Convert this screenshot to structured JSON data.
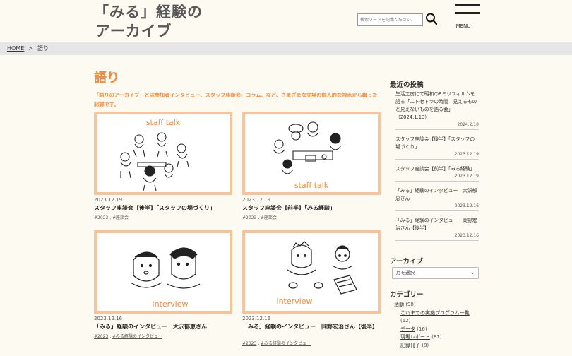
{
  "header": {
    "title_line1": "「みる」経験の",
    "title_line2": "アーカイブ",
    "search_placeholder": "検索ワードを記載ください。",
    "menu_label": "MENU"
  },
  "breadcrumb": {
    "home": "HOME",
    "separator": ">",
    "current": "語り"
  },
  "main": {
    "title": "語り",
    "intro": "「語りのアーカイブ」とは参加者インタビュー、スタッフ座談会、コラム、など、さまざまな立場の個人的な視点から綴った記録です。",
    "posts": [
      {
        "image_caption": "staff talk",
        "date": "2023.12.19",
        "title": "スタッフ座談会【後半】「スタッフの場づくり」",
        "tags": [
          "#2023",
          "#座談会"
        ]
      },
      {
        "image_caption": "staff talk",
        "date": "2023.12.19",
        "title": "スタッフ座談会【前半】「みる経験」",
        "tags": [
          "#2023",
          "#座談会"
        ]
      },
      {
        "image_caption": "interview",
        "date": "2023.12.16",
        "title": "「みる」経験のインタビュー　大沢郁恵さん",
        "tags": [
          "#2023",
          "#みる経験のインタビュー"
        ]
      },
      {
        "image_caption": "interview",
        "date": "2023.12.16",
        "title": "「みる」経験のインタビュー　岡野宏治さん【後半】",
        "tags": [
          "#2023",
          "#みる経験のインタビュー"
        ]
      }
    ]
  },
  "sidebar": {
    "recent_heading": "最近の投稿",
    "recent": [
      {
        "title": "生活工房にて昭和の8ミリフィルムを語る「エトセトラの時間　見えるものと見えないものを語る会」（2024.1.13）",
        "date": "2024.2.10"
      },
      {
        "title": "スタッフ座談会【後半】「スタッフの場づくり」",
        "date": "2023.12.19"
      },
      {
        "title": "スタッフ座談会【前半】「みる経験」",
        "date": "2023.12.19"
      },
      {
        "title": "「みる」経験のインタビュー　大沢郁恵さん",
        "date": "2023.12.16"
      },
      {
        "title": "「みる」経験のインタビュー　岡野宏治さん【後半】",
        "date": "2023.12.16"
      }
    ],
    "archive_heading": "アーカイブ",
    "archive_select": "月を選択",
    "category_heading": "カテゴリー",
    "categories": [
      {
        "label": "活動",
        "count": "(98)",
        "child": false
      },
      {
        "label": "これまでの実施プログラム一覧",
        "count": "(12)",
        "child": true
      },
      {
        "label": "データ",
        "count": "(16)",
        "child": true
      },
      {
        "label": "現場レポート",
        "count": "(81)",
        "child": true
      },
      {
        "label": "記録冊子",
        "count": "(8)",
        "child": true
      }
    ]
  },
  "colors": {
    "accent": "#f08a3c",
    "thumb_border": "#f9c39a",
    "background": "#fdfaf1"
  }
}
